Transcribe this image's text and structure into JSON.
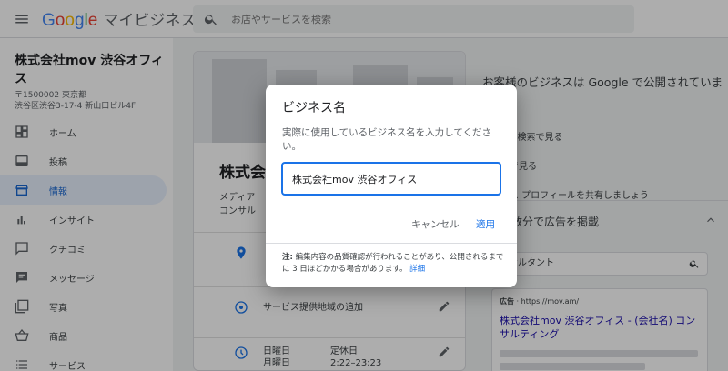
{
  "header": {
    "logo_google": "Google",
    "logo_product": "マイビジネス",
    "search_placeholder": "お店やサービスを検索"
  },
  "business": {
    "name": "株式会社mov 渋谷オフィス",
    "postal": "〒1500002 東京都",
    "address": "渋谷区渋谷3-17-4 新山口ビル4F"
  },
  "sidebar": {
    "items": [
      {
        "label": "ホーム",
        "icon": "dashboard-icon"
      },
      {
        "label": "投稿",
        "icon": "post-icon"
      },
      {
        "label": "情報",
        "icon": "storefront-icon",
        "active": true
      },
      {
        "label": "インサイト",
        "icon": "bar-chart-icon"
      },
      {
        "label": "クチコミ",
        "icon": "review-icon"
      },
      {
        "label": "メッセージ",
        "icon": "message-icon"
      },
      {
        "label": "写真",
        "icon": "photo-library-icon"
      },
      {
        "label": "商品",
        "icon": "basket-icon"
      },
      {
        "label": "サービス",
        "icon": "list-icon"
      }
    ]
  },
  "main": {
    "title": "株式会",
    "subtitle_lines": [
      "メディア",
      "コンサル"
    ],
    "service_area": "サービス提供地域の追加",
    "hours": [
      {
        "day": "日曜日",
        "time": "定休日"
      },
      {
        "day": "月曜日",
        "time": "2:22–23:23"
      }
    ]
  },
  "right_panel": {
    "title": "お客様のビジネスは Google で公開されています",
    "items": [
      "Google 検索で見る",
      "マップで見る",
      "ビジネス プロフィールを共有しましょう"
    ],
    "ad_title": "数分で広告を掲載",
    "ad_search_value": "ンサルタント",
    "ad_label": "広告",
    "ad_url": "https://mov.am/",
    "ad_headline": "株式会社mov 渋谷オフィス - (会社名) コンサルティング"
  },
  "dialog": {
    "title": "ビジネス名",
    "description": "実際に使用しているビジネス名を入力してください。",
    "input_value": "株式会社mov 渋谷オフィス",
    "cancel_label": "キャンセル",
    "apply_label": "適用",
    "note_prefix": "注:",
    "note_text": "編集内容の品質確認が行われることがあり、公開されるまでに 3 日ほどかかる場合があります。",
    "note_link": "詳細"
  },
  "colors": {
    "accent": "#1a73e8",
    "active_nav_bg": "#e8f0fe",
    "overlay": "rgba(0,0,0,0.32)"
  }
}
